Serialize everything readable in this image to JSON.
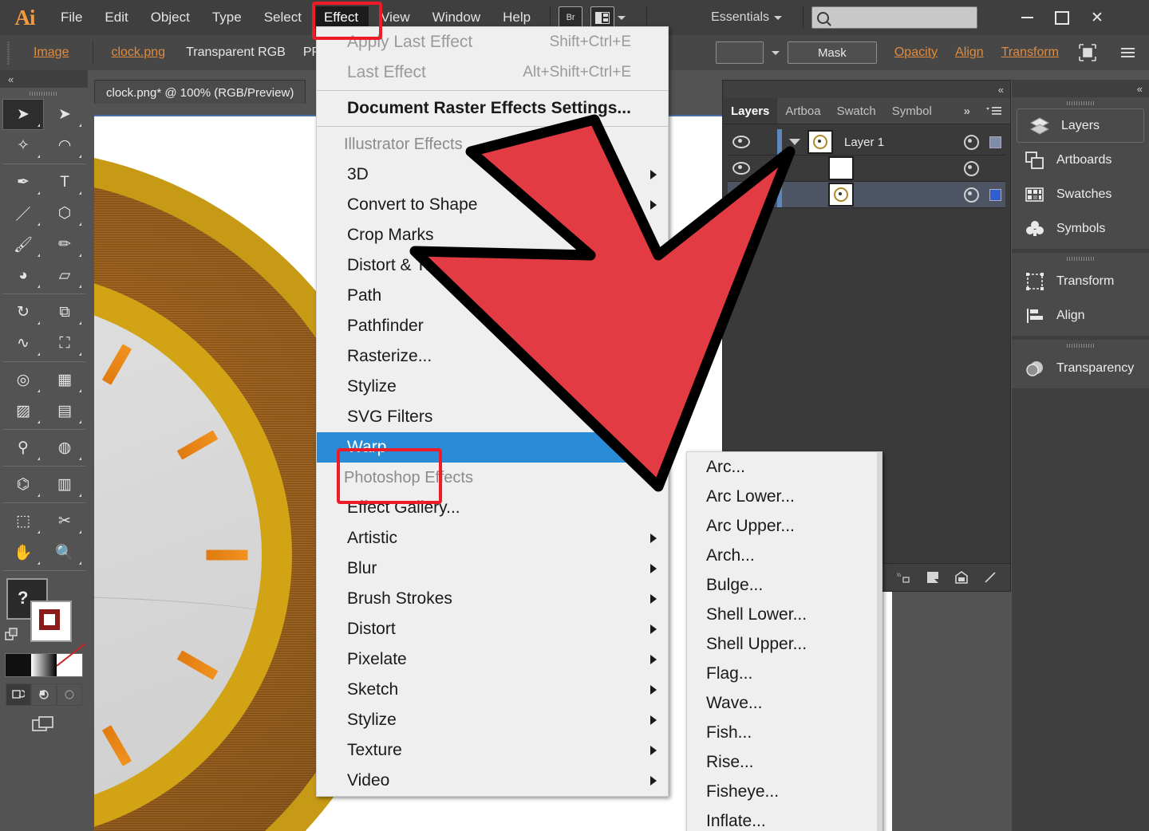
{
  "app": {
    "name": "Adobe Illustrator",
    "logo_text": "Ai",
    "workspace": "Essentials",
    "search_placeholder": ""
  },
  "menubar": {
    "items": [
      {
        "label": "File",
        "active": false
      },
      {
        "label": "Edit",
        "active": false
      },
      {
        "label": "Object",
        "active": false
      },
      {
        "label": "Type",
        "active": false
      },
      {
        "label": "Select",
        "active": false
      },
      {
        "label": "Effect",
        "active": true
      },
      {
        "label": "View",
        "active": false
      },
      {
        "label": "Window",
        "active": false
      },
      {
        "label": "Help",
        "active": false
      }
    ],
    "bridge_button": "Br",
    "arrange_button": "Arrange Documents",
    "window_controls": {
      "minimize": "–",
      "maximize": "□",
      "close": "✕"
    }
  },
  "control_bar": {
    "object_type": "Image",
    "file_name": "clock.png",
    "color_mode": "Transparent RGB",
    "ppi_label": "PPI",
    "mask_button": "Mask",
    "opacity_label": "Opacity",
    "align_label": "Align",
    "transform_label": "Transform"
  },
  "document": {
    "tab_title": "clock.png* @ 100% (RGB/Preview)"
  },
  "tools": {
    "items": [
      {
        "name": "selection-tool",
        "glyph": "➤",
        "selected": true
      },
      {
        "name": "direct-selection-tool",
        "glyph": "➤",
        "selected": false
      },
      {
        "name": "magic-wand-tool",
        "glyph": "✧",
        "selected": false
      },
      {
        "name": "lasso-tool",
        "glyph": "◠",
        "selected": false
      },
      {
        "name": "pen-tool",
        "glyph": "✒",
        "selected": false
      },
      {
        "name": "type-tool",
        "glyph": "T",
        "selected": false
      },
      {
        "name": "line-segment-tool",
        "glyph": "／",
        "selected": false
      },
      {
        "name": "shape-tool",
        "glyph": "⬡",
        "selected": false
      },
      {
        "name": "paintbrush-tool",
        "glyph": "🖌",
        "selected": false
      },
      {
        "name": "pencil-tool",
        "glyph": "✏",
        "selected": false
      },
      {
        "name": "blob-brush-tool",
        "glyph": "◕",
        "selected": false
      },
      {
        "name": "eraser-tool",
        "glyph": "▱",
        "selected": false
      },
      {
        "name": "rotate-tool",
        "glyph": "↻",
        "selected": false
      },
      {
        "name": "scale-tool",
        "glyph": "⧉",
        "selected": false
      },
      {
        "name": "width-tool",
        "glyph": "∿",
        "selected": false
      },
      {
        "name": "free-transform-tool",
        "glyph": "⛶",
        "selected": false
      },
      {
        "name": "shape-builder-tool",
        "glyph": "◎",
        "selected": false
      },
      {
        "name": "perspective-grid-tool",
        "glyph": "▦",
        "selected": false
      },
      {
        "name": "mesh-tool",
        "glyph": "▨",
        "selected": false
      },
      {
        "name": "gradient-tool",
        "glyph": "▤",
        "selected": false
      },
      {
        "name": "eyedropper-tool",
        "glyph": "⚲",
        "selected": false
      },
      {
        "name": "blend-tool",
        "glyph": "◍",
        "selected": false
      },
      {
        "name": "symbol-sprayer-tool",
        "glyph": "⌬",
        "selected": false
      },
      {
        "name": "column-graph-tool",
        "glyph": "▥",
        "selected": false
      },
      {
        "name": "artboard-tool",
        "glyph": "⬚",
        "selected": false
      },
      {
        "name": "slice-tool",
        "glyph": "✂",
        "selected": false
      },
      {
        "name": "hand-tool",
        "glyph": "✋",
        "selected": false
      },
      {
        "name": "zoom-tool",
        "glyph": "🔍",
        "selected": false
      }
    ],
    "fill_stroke": {
      "help_glyph": "?"
    },
    "color_modes": [
      "color",
      "gradient",
      "none"
    ],
    "draw_modes": [
      "draw-normal",
      "draw-behind",
      "draw-inside"
    ],
    "screen_mode": "change-screen-mode"
  },
  "effect_menu": {
    "top": [
      {
        "label": "Apply Last Effect",
        "shortcut": "Shift+Ctrl+E",
        "disabled": true,
        "arrow": false
      },
      {
        "label": "Last Effect",
        "shortcut": "Alt+Shift+Ctrl+E",
        "disabled": true,
        "arrow": false
      }
    ],
    "document_settings": {
      "label": "Document Raster Effects Settings...",
      "shortcut": "",
      "disabled": false,
      "arrow": false
    },
    "illustrator_group_label": "Illustrator Effects",
    "illustrator_effects": [
      {
        "label": "3D",
        "arrow": true,
        "highlighted": false
      },
      {
        "label": "Convert to Shape",
        "arrow": true,
        "highlighted": false
      },
      {
        "label": "Crop Marks",
        "arrow": false,
        "highlighted": false
      },
      {
        "label": "Distort & Transform",
        "arrow": true,
        "highlighted": false
      },
      {
        "label": "Path",
        "arrow": true,
        "highlighted": false
      },
      {
        "label": "Pathfinder",
        "arrow": true,
        "highlighted": false
      },
      {
        "label": "Rasterize...",
        "arrow": false,
        "highlighted": false
      },
      {
        "label": "Stylize",
        "arrow": true,
        "highlighted": false
      },
      {
        "label": "SVG Filters",
        "arrow": true,
        "highlighted": false
      },
      {
        "label": "Warp",
        "arrow": true,
        "highlighted": true
      }
    ],
    "photoshop_group_label": "Photoshop Effects",
    "photoshop_effects": [
      {
        "label": "Effect Gallery...",
        "arrow": false,
        "highlighted": false
      },
      {
        "label": "Artistic",
        "arrow": true,
        "highlighted": false
      },
      {
        "label": "Blur",
        "arrow": true,
        "highlighted": false
      },
      {
        "label": "Brush Strokes",
        "arrow": true,
        "highlighted": false
      },
      {
        "label": "Distort",
        "arrow": true,
        "highlighted": false
      },
      {
        "label": "Pixelate",
        "arrow": true,
        "highlighted": false
      },
      {
        "label": "Sketch",
        "arrow": true,
        "highlighted": false
      },
      {
        "label": "Stylize",
        "arrow": true,
        "highlighted": false
      },
      {
        "label": "Texture",
        "arrow": true,
        "highlighted": false
      },
      {
        "label": "Video",
        "arrow": true,
        "highlighted": false
      }
    ]
  },
  "warp_submenu": {
    "items": [
      {
        "label": "Arc..."
      },
      {
        "label": "Arc Lower..."
      },
      {
        "label": "Arc Upper..."
      },
      {
        "label": "Arch..."
      },
      {
        "label": "Bulge..."
      },
      {
        "label": "Shell Lower..."
      },
      {
        "label": "Shell Upper..."
      },
      {
        "label": "Flag..."
      },
      {
        "label": "Wave..."
      },
      {
        "label": "Fish..."
      },
      {
        "label": "Rise..."
      },
      {
        "label": "Fisheye..."
      },
      {
        "label": "Inflate..."
      }
    ]
  },
  "layers_panel": {
    "tabs": [
      {
        "label": "Layers",
        "active": true
      },
      {
        "label": "Artboa",
        "active": false
      },
      {
        "label": "Swatch",
        "active": false
      },
      {
        "label": "Symbol",
        "active": false
      }
    ],
    "rows": [
      {
        "name": "Layer 1",
        "selected": false,
        "has_triangle": true,
        "has_swatch": true,
        "swatch_color": "#7f8da6"
      },
      {
        "name": "",
        "selected": false,
        "has_triangle": false,
        "has_swatch": false,
        "swatch_color": ""
      },
      {
        "name": "",
        "selected": true,
        "has_triangle": false,
        "has_swatch": true,
        "swatch_color": "#2f5fd0"
      }
    ],
    "footer_icons": [
      "locate-object-icon",
      "new-sublayer-icon",
      "new-layer-icon",
      "delete-layer-icon"
    ]
  },
  "dock": {
    "groups": [
      {
        "items": [
          {
            "label": "Layers",
            "icon": "layers-icon",
            "active": true
          },
          {
            "label": "Artboards",
            "icon": "artboards-icon",
            "active": false
          },
          {
            "label": "Swatches",
            "icon": "swatches-icon",
            "active": false
          },
          {
            "label": "Symbols",
            "icon": "symbols-icon",
            "active": false
          }
        ]
      },
      {
        "items": [
          {
            "label": "Transform",
            "icon": "transform-icon",
            "active": false
          },
          {
            "label": "Align",
            "icon": "align-icon",
            "active": false
          }
        ]
      },
      {
        "items": [
          {
            "label": "Transparency",
            "icon": "transparency-icon",
            "active": false
          }
        ]
      }
    ]
  },
  "annotations": {
    "highlight_color": "#ee1c28",
    "selection_color": "#2a8bd6",
    "arrow_color": "#e23b44",
    "arrow_outline": "#000000"
  },
  "artwork": {
    "description": "wall clock",
    "rim_color": "#c79a15",
    "wood_color": "#8a5314",
    "face_color": "#d9d9d9",
    "tick_color": "#ef8c1b",
    "tick_count": 12
  }
}
